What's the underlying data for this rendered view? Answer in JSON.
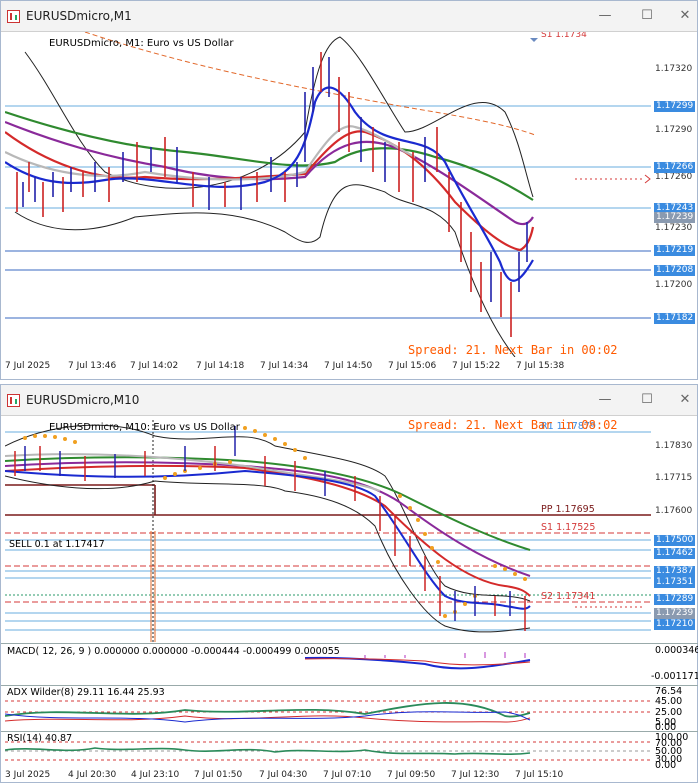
{
  "window1": {
    "title": "EURUSDmicro,M1",
    "chart_label": "EURUSDmicro, M1:  Euro vs US Dollar",
    "spread_text": "Spread: 21. Next Bar in 00:02",
    "cut_label": "S1 1.1734",
    "price_ticks": [
      "1.17320",
      "1.17290",
      "1.17260",
      "1.17230",
      "1.17200"
    ],
    "price_labels": [
      "1.17299",
      "1.17266",
      "1.17243",
      "1.17239",
      "1.17219",
      "1.17208",
      "1.17182"
    ],
    "time_labels": [
      "7 Jul 2025",
      "7 Jul 13:46",
      "7 Jul 14:02",
      "7 Jul 14:18",
      "7 Jul 14:34",
      "7 Jul 14:50",
      "7 Jul 15:06",
      "7 Jul 15:22",
      "7 Jul 15:38"
    ]
  },
  "window2": {
    "title": "EURUSDmicro,M10",
    "chart_label": "EURUSDmicro, M10:  Euro vs US Dollar",
    "spread_text": "Spread: 21. Next Bar in 08:02",
    "levels": {
      "r1": "R1 1.17879",
      "pp": "PP 1.17695",
      "s1": "S1 1.17525",
      "s2": "S2 1.17341"
    },
    "sell_label": "SELL 0.1 at 1.17417",
    "price_ticks": [
      "1.17830",
      "1.17715",
      "1.17600"
    ],
    "price_labels": [
      "1.17500",
      "1.17462",
      "1.17387",
      "1.17351",
      "1.17289",
      "1.17239",
      "1.17210"
    ],
    "macd_label": "MACD( 12, 26, 9 ) 0.000000 0.000000 -0.000444 -0.000499 0.000055",
    "macd_ticks": [
      "0.000346",
      "-0.001171"
    ],
    "adx_label": "ADX Wilder(8) 29.11 16.44 25.93",
    "adx_ticks": [
      "76.54",
      "45.00",
      "25.00",
      "5.00",
      "0.00"
    ],
    "rsi_label": "RSI(14) 40.87",
    "rsi_ticks": [
      "100.00",
      "70.00",
      "50.00",
      "30.00",
      "0.00"
    ],
    "time_labels": [
      "3 Jul 2025",
      "4 Jul 20:30",
      "4 Jul 23:10",
      "7 Jul 01:50",
      "7 Jul 04:30",
      "7 Jul 07:10",
      "7 Jul 09:50",
      "7 Jul 12:30",
      "7 Jul 15:10"
    ]
  },
  "colors": {
    "accent": "#3a8be0",
    "spread": "#ff5a00",
    "pivot": "#7a1a1a",
    "level_red": "#d43a3a"
  }
}
